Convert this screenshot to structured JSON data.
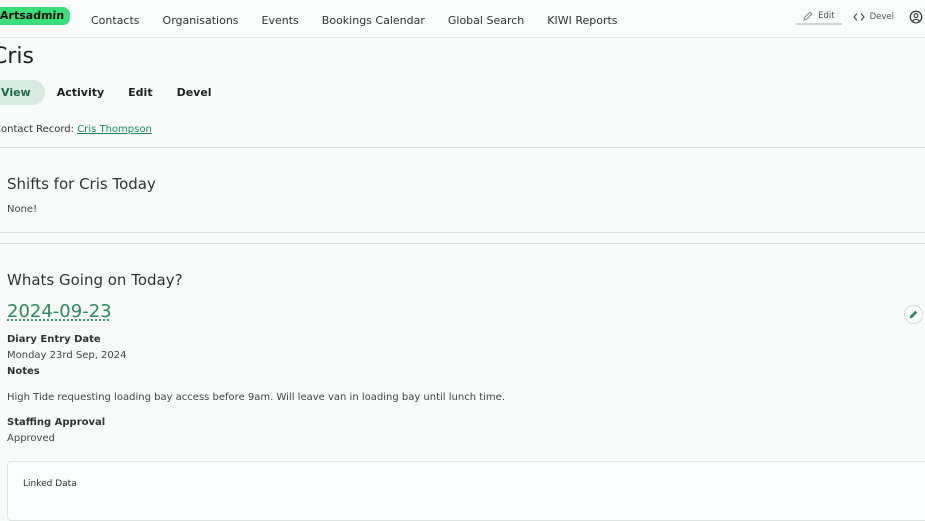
{
  "header": {
    "logo": "Artsadmin",
    "nav": [
      "Contacts",
      "Organisations",
      "Events",
      "Bookings Calendar",
      "Global Search",
      "KIWI Reports"
    ],
    "edit_label": "Edit",
    "devel_label": "Devel",
    "icons": {
      "edit": "pencil-icon",
      "devel": "code-icon",
      "user": "user-circle-icon"
    }
  },
  "page": {
    "title": "Cris",
    "tabs": [
      {
        "label": "View",
        "active": true
      },
      {
        "label": "Activity",
        "active": false
      },
      {
        "label": "Edit",
        "active": false
      },
      {
        "label": "Devel",
        "active": false
      }
    ],
    "contact_prefix": "Contact Record:",
    "contact_name": "Cris Thompson"
  },
  "shifts": {
    "title": "Shifts for Cris Today",
    "value": "None!"
  },
  "today": {
    "title": "Whats Going on Today?",
    "date": "2024-09-23",
    "diary_label": "Diary Entry Date",
    "diary_value": "Monday 23rd Sep, 2024",
    "notes_label": "Notes",
    "notes_value": "High Tide requesting loading bay access before 9am. Will leave van in loading bay until lunch time.",
    "staffing_label": "Staffing Approval",
    "staffing_value": "Approved",
    "linked_label": "Linked Data"
  },
  "colors": {
    "accent": "#2a8a5f",
    "logo_bg": "#39e079",
    "tab_active_bg": "#d7ebe2",
    "background": "#f7fbf9"
  }
}
